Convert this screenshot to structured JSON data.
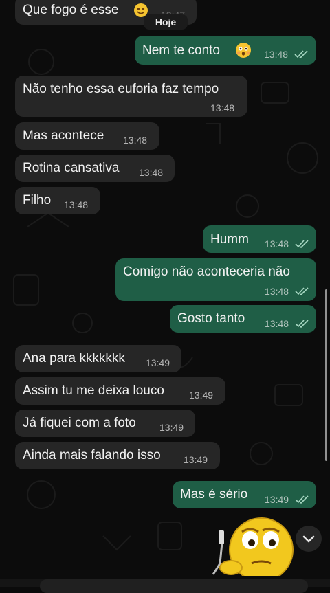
{
  "date_divider": "Hoje",
  "messages": [
    {
      "direction": "in",
      "text": "Que fogo é esse",
      "emoji": "smiling-face-icon",
      "time": "13:47"
    },
    {
      "direction": "out",
      "text": "Nem te conto",
      "emoji": "flushed-face-icon",
      "time": "13:48",
      "status": "read"
    },
    {
      "direction": "in",
      "text": "Não tenho essa euforia faz tempo",
      "time": "13:48"
    },
    {
      "direction": "in",
      "text": "Mas acontece",
      "time": "13:48"
    },
    {
      "direction": "in",
      "text": "Rotina cansativa",
      "time": "13:48"
    },
    {
      "direction": "in",
      "text": "Filho",
      "time": "13:48"
    },
    {
      "direction": "out",
      "text": "Humm",
      "time": "13:48",
      "status": "read"
    },
    {
      "direction": "out",
      "text": "Comigo não aconteceria não",
      "time": "13:48",
      "status": "read"
    },
    {
      "direction": "out",
      "text": "Gosto tanto",
      "time": "13:48",
      "status": "read"
    },
    {
      "direction": "in",
      "text": "Ana para kkkkkkk",
      "time": "13:49"
    },
    {
      "direction": "in",
      "text": "Assim tu me deixa louco",
      "time": "13:49"
    },
    {
      "direction": "in",
      "text": "Já fiquei com a foto",
      "time": "13:49"
    },
    {
      "direction": "in",
      "text": "Ainda mais falando isso",
      "time": "13:49"
    },
    {
      "direction": "out",
      "text": "Mas é sério",
      "time": "13:49",
      "status": "read"
    }
  ],
  "sticker": "thinking-smiley-sticker",
  "scroll_button": "chevron-down-icon",
  "colors": {
    "incoming": "#262626",
    "outgoing": "#1f5e46",
    "background": "#0c0c0c",
    "read_ticks": "#a9d9c4"
  }
}
